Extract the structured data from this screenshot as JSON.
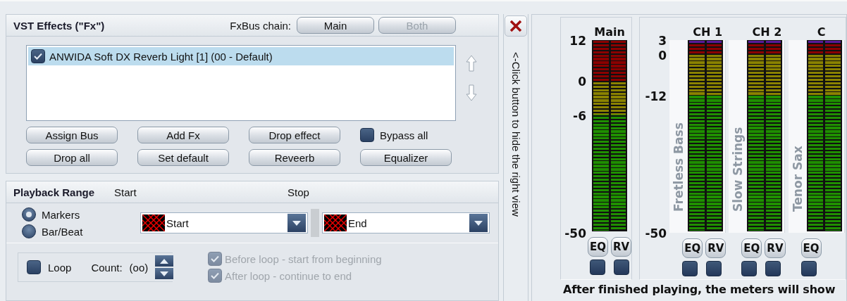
{
  "vst": {
    "title": "VST Effects (\"Fx\")",
    "chain_label": "FxBus chain:",
    "chain_buttons": [
      {
        "label": "Main",
        "disabled": false
      },
      {
        "label": "Both",
        "disabled": true
      }
    ],
    "effects": [
      {
        "label": "ANWIDA Soft DX Reverb Light [1] (00 - Default)",
        "checked": true,
        "selected": true
      }
    ],
    "buttons": [
      {
        "kind": "button",
        "label": "Assign Bus"
      },
      {
        "kind": "button",
        "label": "Add Fx"
      },
      {
        "kind": "button",
        "label": "Drop effect"
      },
      {
        "kind": "checkbox",
        "label": "Bypass all",
        "checked": false
      },
      {
        "kind": "button",
        "label": "Drop all"
      },
      {
        "kind": "button",
        "label": "Set default"
      },
      {
        "kind": "button",
        "label": "Reveerb"
      },
      {
        "kind": "button",
        "label": "Equalizer"
      }
    ]
  },
  "playback": {
    "title": "Playback Range",
    "start_label": "Start",
    "stop_label": "Stop",
    "modes": [
      {
        "label": "Markers",
        "selected": true
      },
      {
        "label": "Bar/Beat",
        "selected": false
      }
    ],
    "start_value": "Start",
    "stop_value": "End",
    "loop": {
      "label": "Loop",
      "checked": false,
      "count_label": "Count:",
      "count_value": "(oo)"
    },
    "options": [
      {
        "label": "Before loop - start from beginning",
        "checked": true,
        "disabled": true
      },
      {
        "label": "After loop - continue to end",
        "checked": true,
        "disabled": true
      }
    ]
  },
  "hide_hint": "<-Click button to hide the right view",
  "meters": {
    "main": {
      "title": "Main",
      "scale": [
        "12",
        "0",
        "-6",
        "-50"
      ],
      "buttons": [
        {
          "label": "EQ",
          "on": false
        },
        {
          "label": "RV",
          "on": false
        }
      ]
    },
    "channel_scale": [
      "3",
      "0",
      "-12",
      "-50"
    ],
    "channels": [
      {
        "title": "CH 1",
        "name": "Fretless Bass",
        "buttons": [
          {
            "label": "EQ",
            "on": false
          },
          {
            "label": "RV",
            "on": false
          }
        ]
      },
      {
        "title": "CH 2",
        "name": "Slow Strings",
        "buttons": [
          {
            "label": "EQ",
            "on": false
          },
          {
            "label": "RV",
            "on": false
          }
        ]
      },
      {
        "title": "C",
        "name": "Tenor Sax",
        "buttons": [
          {
            "label": "EQ",
            "on": false
          }
        ]
      }
    ]
  },
  "footer": "After finished playing, the meters will show"
}
